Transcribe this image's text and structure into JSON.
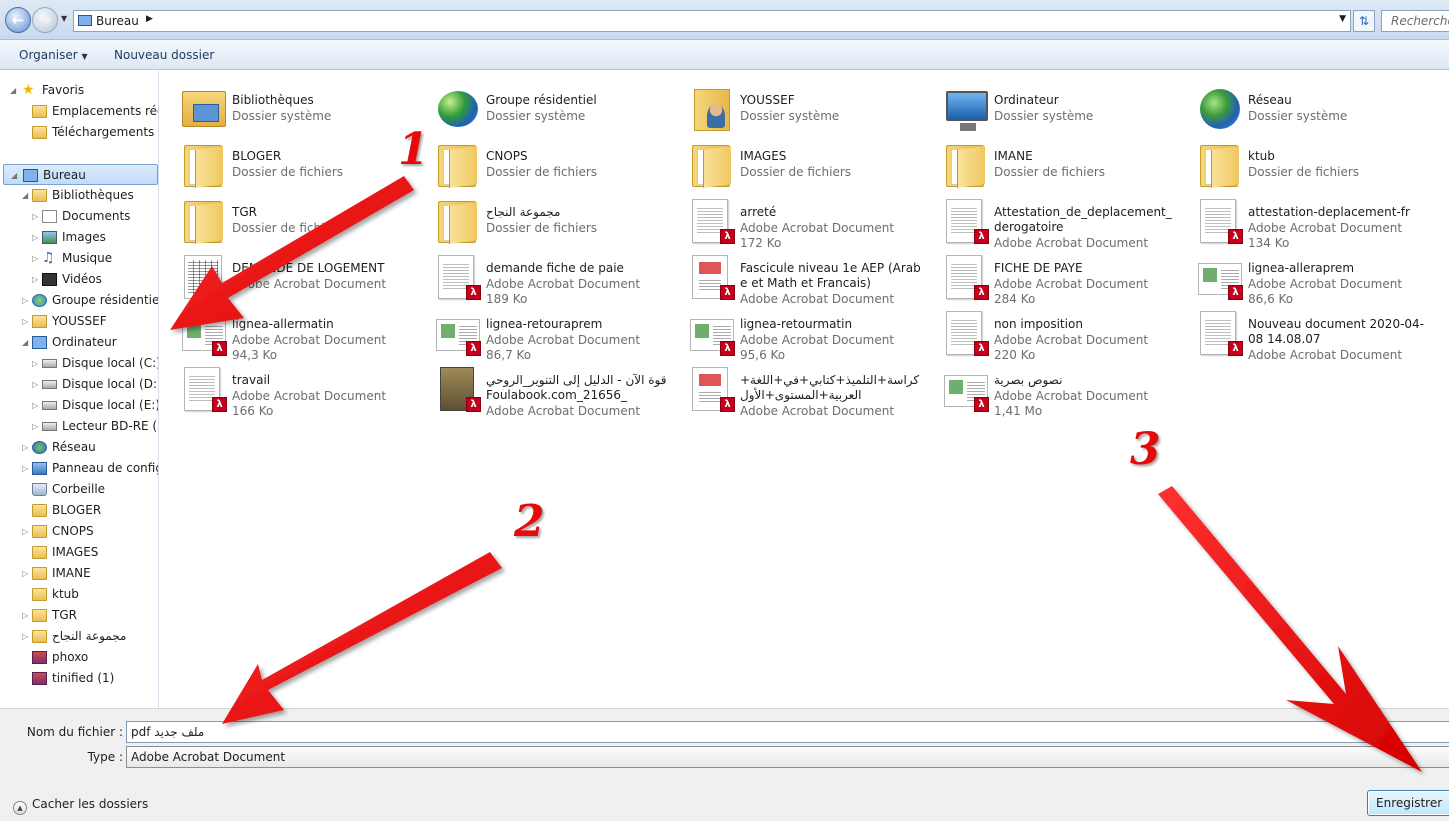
{
  "address": {
    "crumb": "Bureau",
    "search_placeholder": "Rechercher"
  },
  "toolbar": {
    "organize": "Organiser",
    "new_folder": "Nouveau dossier"
  },
  "sidebar": {
    "items": [
      {
        "label": "Favoris",
        "icon": "star-icon"
      },
      {
        "label": "Emplacements réce",
        "icon": "folder-icon"
      },
      {
        "label": "Téléchargements",
        "icon": "folder-icon"
      },
      {
        "label": "Bureau",
        "icon": "desktop-icon"
      },
      {
        "label": "Bibliothèques",
        "icon": "library-icon"
      },
      {
        "label": "Documents",
        "icon": "document-icon"
      },
      {
        "label": "Images",
        "icon": "image-icon"
      },
      {
        "label": "Musique",
        "icon": "music-icon"
      },
      {
        "label": "Vidéos",
        "icon": "video-icon"
      },
      {
        "label": "Groupe résidentiel",
        "icon": "homegroup-icon"
      },
      {
        "label": "YOUSSEF",
        "icon": "user-folder-icon"
      },
      {
        "label": "Ordinateur",
        "icon": "computer-icon"
      },
      {
        "label": "Disque local (C:)",
        "icon": "drive-icon"
      },
      {
        "label": "Disque local (D:)",
        "icon": "drive-icon"
      },
      {
        "label": "Disque local (E:)",
        "icon": "drive-icon"
      },
      {
        "label": "Lecteur BD-RE (F:)",
        "icon": "optical-drive-icon"
      },
      {
        "label": "Réseau",
        "icon": "network-icon"
      },
      {
        "label": "Panneau de configu",
        "icon": "control-panel-icon"
      },
      {
        "label": "Corbeille",
        "icon": "recycle-bin-icon"
      },
      {
        "label": "BLOGER",
        "icon": "folder-icon"
      },
      {
        "label": "CNOPS",
        "icon": "folder-icon"
      },
      {
        "label": "IMAGES",
        "icon": "folder-icon"
      },
      {
        "label": "IMANE",
        "icon": "folder-icon"
      },
      {
        "label": "ktub",
        "icon": "folder-icon"
      },
      {
        "label": "TGR",
        "icon": "folder-icon"
      },
      {
        "label": "مجموعة النجاح",
        "icon": "folder-icon"
      },
      {
        "label": "phoxo",
        "icon": "box-icon"
      },
      {
        "label": "tinified (1)",
        "icon": "box-icon"
      }
    ]
  },
  "files": [
    {
      "name": "Bibliothèques",
      "sub": "Dossier système",
      "size": "",
      "kind": "library"
    },
    {
      "name": "Groupe résidentiel",
      "sub": "Dossier système",
      "size": "",
      "kind": "homegroup"
    },
    {
      "name": "YOUSSEF",
      "sub": "Dossier système",
      "size": "",
      "kind": "user"
    },
    {
      "name": "Ordinateur",
      "sub": "Dossier système",
      "size": "",
      "kind": "computer"
    },
    {
      "name": "Réseau",
      "sub": "Dossier système",
      "size": "",
      "kind": "network"
    },
    {
      "name": "BLOGER",
      "sub": "Dossier de fichiers",
      "size": "",
      "kind": "folder"
    },
    {
      "name": "CNOPS",
      "sub": "Dossier de fichiers",
      "size": "",
      "kind": "folder"
    },
    {
      "name": "IMAGES",
      "sub": "Dossier de fichiers",
      "size": "",
      "kind": "folder"
    },
    {
      "name": "IMANE",
      "sub": "Dossier de fichiers",
      "size": "",
      "kind": "folder"
    },
    {
      "name": "ktub",
      "sub": "Dossier de fichiers",
      "size": "",
      "kind": "folder"
    },
    {
      "name": "TGR",
      "sub": "Dossier de fichiers",
      "size": "",
      "kind": "folder"
    },
    {
      "name": "مجموعة النجاح",
      "sub": "Dossier de fichiers",
      "size": "",
      "kind": "folder"
    },
    {
      "name": "arreté",
      "sub": "Adobe Acrobat Document",
      "size": "172 Ko",
      "kind": "pdf"
    },
    {
      "name": "Attestation_de_deplacement_derogatoire",
      "sub": "Adobe Acrobat Document",
      "size": "",
      "kind": "pdf"
    },
    {
      "name": "attestation-deplacement-fr",
      "sub": "Adobe Acrobat Document",
      "size": "134 Ko",
      "kind": "pdf"
    },
    {
      "name": "DEMANDE DE LOGEMENT",
      "sub": "Adobe Acrobat Document",
      "size": "",
      "kind": "pdf-table"
    },
    {
      "name": "demande fiche de paie",
      "sub": "Adobe Acrobat Document",
      "size": "189 Ko",
      "kind": "pdf"
    },
    {
      "name": "Fascicule niveau 1e AEP (Arabe et Math et Francais)",
      "sub": "Adobe Acrobat Document",
      "size": "",
      "kind": "pdf-color"
    },
    {
      "name": "FICHE DE PAYE",
      "sub": "Adobe Acrobat Document",
      "size": "284 Ko",
      "kind": "pdf"
    },
    {
      "name": "lignea-alleraprem",
      "sub": "Adobe Acrobat Document",
      "size": "86,6 Ko",
      "kind": "pdf-wide"
    },
    {
      "name": "lignea-allermatin",
      "sub": "Adobe Acrobat Document",
      "size": "94,3 Ko",
      "kind": "pdf-wide"
    },
    {
      "name": "lignea-retouraprem",
      "sub": "Adobe Acrobat Document",
      "size": "86,7 Ko",
      "kind": "pdf-wide"
    },
    {
      "name": "lignea-retourmatin",
      "sub": "Adobe Acrobat Document",
      "size": "95,6 Ko",
      "kind": "pdf-wide"
    },
    {
      "name": "non imposition",
      "sub": "Adobe Acrobat Document",
      "size": "220 Ko",
      "kind": "pdf"
    },
    {
      "name": "Nouveau document 2020-04-08 14.08.07",
      "sub": "Adobe Acrobat Document",
      "size": "",
      "kind": "pdf"
    },
    {
      "name": "travail",
      "sub": "Adobe Acrobat Document",
      "size": "166 Ko",
      "kind": "pdf"
    },
    {
      "name": "قوة الآن - الدليل إلى التنوير_الروحي_21656_Foulabook.com",
      "sub": "Adobe Acrobat Document",
      "size": "",
      "kind": "book"
    },
    {
      "name": "كراسة+التلميذ+كتابي+في+اللغة+العربية+المستوى+الأول",
      "sub": "Adobe Acrobat Document",
      "size": "",
      "kind": "pdf-color"
    },
    {
      "name": "نصوص بصرية",
      "sub": "Adobe Acrobat Document",
      "size": "1,41 Mo",
      "kind": "pdf-wide"
    }
  ],
  "save": {
    "filename_label": "Nom du fichier :",
    "filename_value": "ملف جديد pdf",
    "type_label": "Type :",
    "type_value": "Adobe Acrobat Document",
    "hide_folders": "Cacher les dossiers",
    "save_button": "Enregistrer"
  },
  "annotations": [
    "1",
    "2",
    "3"
  ],
  "colors": {
    "annotation_red": "#e80a0a",
    "selection_blue": "#c1dbfc"
  }
}
